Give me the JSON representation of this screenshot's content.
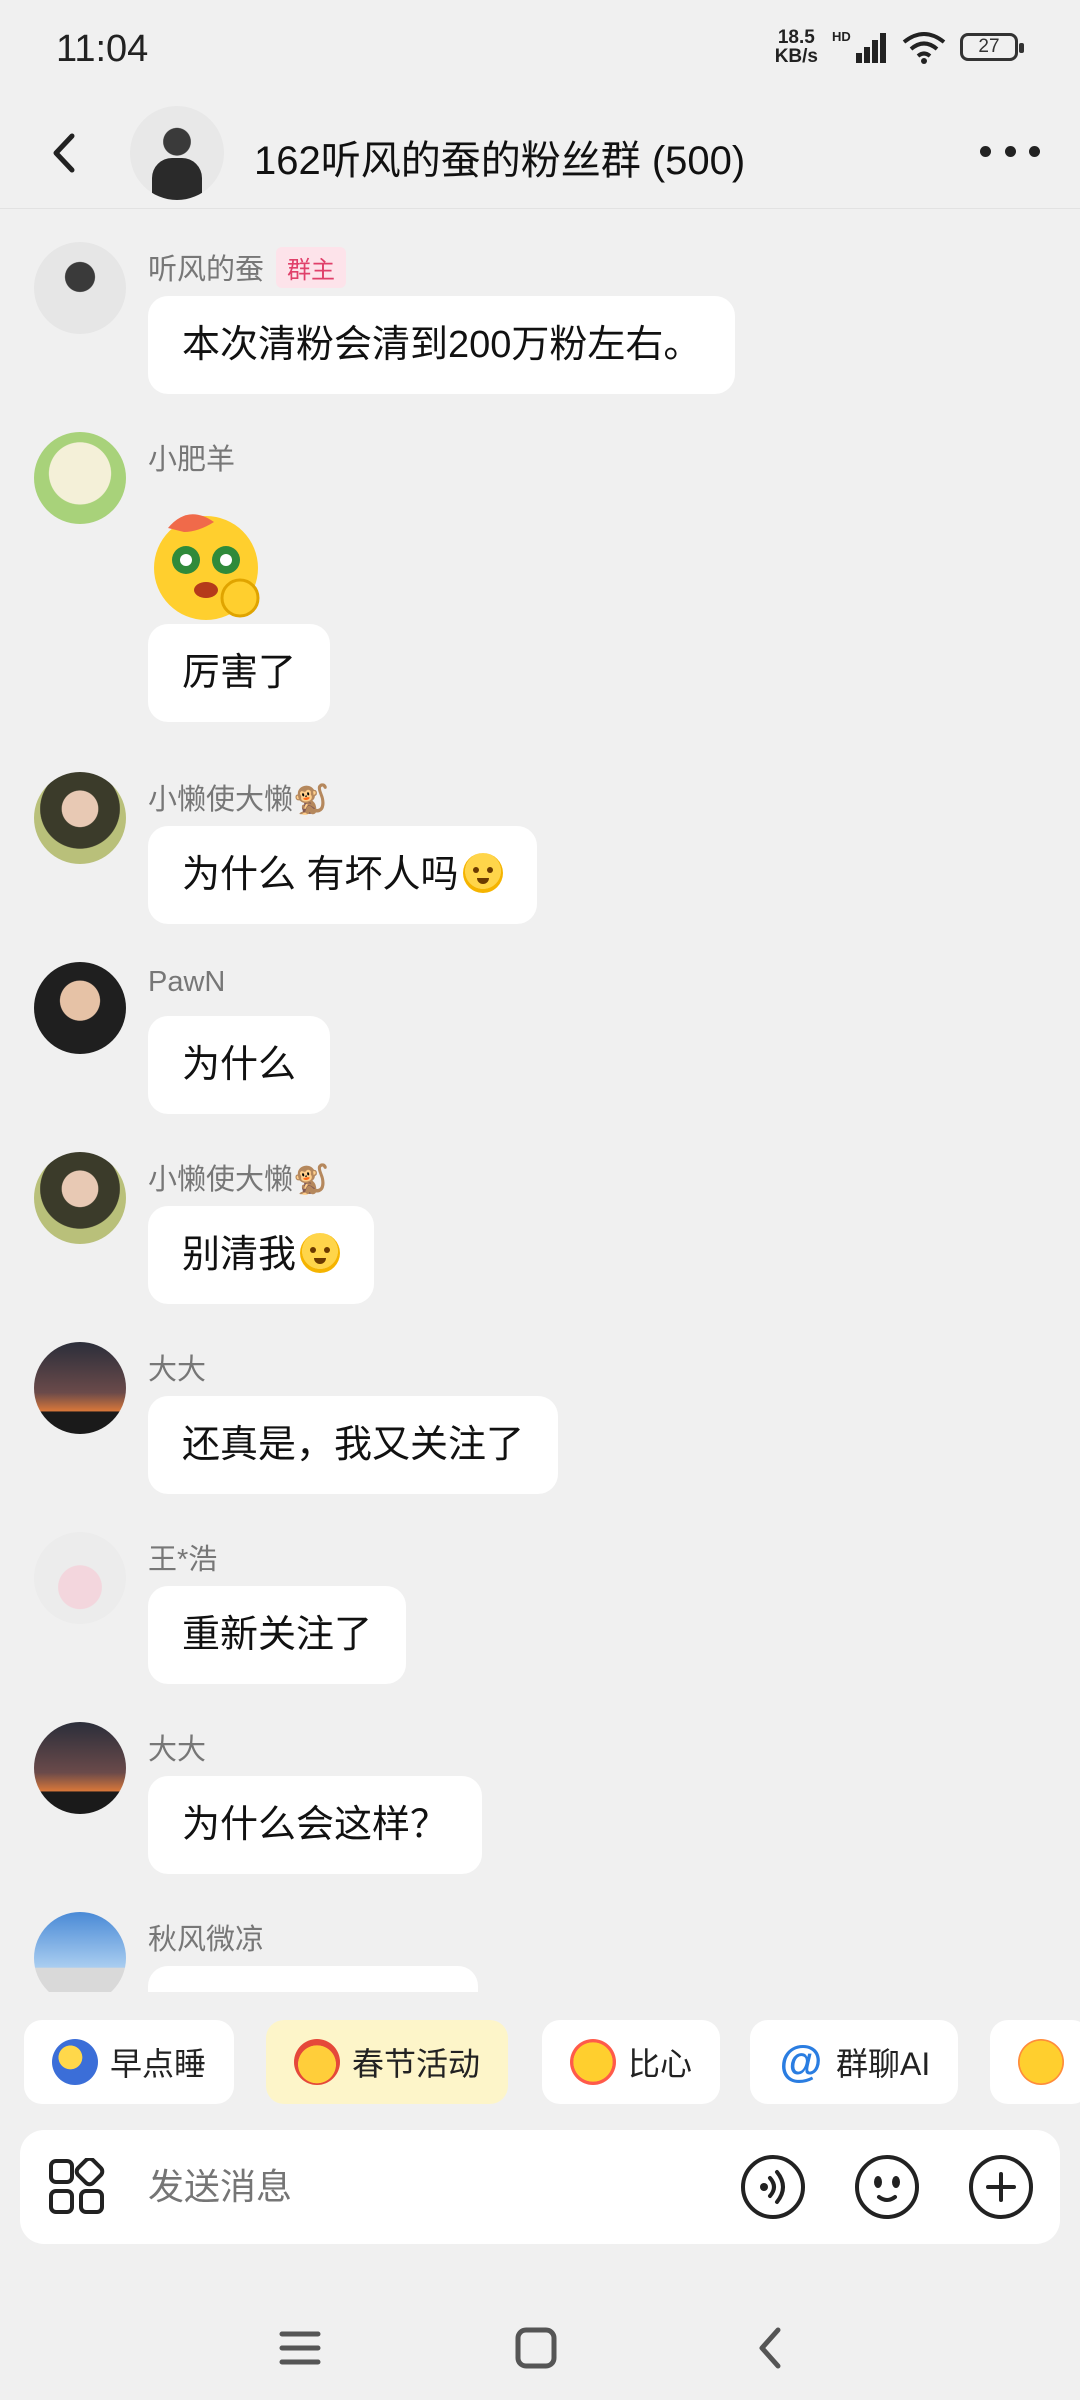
{
  "status_bar": {
    "time": "11:04",
    "net_speed_value": "18.5",
    "net_speed_unit": "KB/s",
    "net_type": "HD",
    "battery": "27"
  },
  "header": {
    "title": "162听风的蚕的粉丝群 (500)",
    "back_icon": "back-chevron-icon",
    "more_icon": "more-dots-icon"
  },
  "messages": [
    {
      "sender": "听风的蚕",
      "badge": "群主",
      "text": "本次清粉会清到200万粉左右。"
    },
    {
      "sender": "小肥羊",
      "sticker": "happy-sticker",
      "text": "厉害了"
    },
    {
      "sender": "小懒使大懒🐒",
      "text": "为什么  有坏人吗",
      "emoji": "pleading-face"
    },
    {
      "sender": "PawN",
      "text": "为什么"
    },
    {
      "sender": "小懒使大懒🐒",
      "text": "别清我",
      "emoji": "pleading-face"
    },
    {
      "sender": "大大",
      "text": "还真是，我又关注了"
    },
    {
      "sender": "王*浩",
      "text": "重新关注了"
    },
    {
      "sender": "大大",
      "text": "为什么会这样？"
    },
    {
      "sender": "秋风微凉",
      "text": ""
    }
  ],
  "quick_actions": [
    {
      "label": "早点睡",
      "icon": "moon-icon"
    },
    {
      "label": "春节活动",
      "icon": "spring-festival-icon"
    },
    {
      "label": "比心",
      "icon": "heart-hand-icon"
    },
    {
      "label": "群聊AI",
      "icon": "at-icon"
    }
  ],
  "input": {
    "placeholder": "发送消息"
  },
  "colors": {
    "background": "#f0f0f0",
    "bubble": "#ffffff",
    "owner_badge": "#e0406a",
    "active_chip": "#fdf5c9"
  }
}
